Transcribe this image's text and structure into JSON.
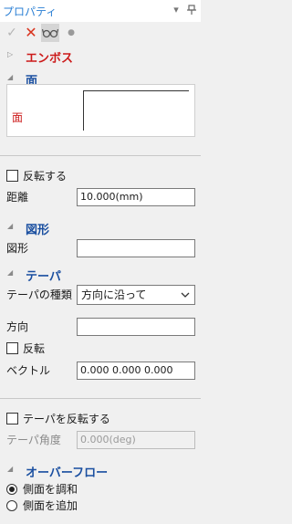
{
  "panel": {
    "title": "プロパティ",
    "pin_glyph": "▾",
    "dock_glyph": "ᵖ"
  },
  "toolbar": {
    "ok_glyph": "✓",
    "cancel_glyph": "✕",
    "preview_glyph": "∞",
    "dot_glyph": "●"
  },
  "sections": {
    "emboss": {
      "caret": "▷",
      "title": "エンボス"
    },
    "face": {
      "caret": "◢",
      "title": "面",
      "list_label": "面"
    },
    "reverse": {
      "label": "反転する",
      "checked": false
    },
    "distance": {
      "label": "距離",
      "value": "10.000(mm)"
    },
    "shape": {
      "caret": "◢",
      "title": "図形",
      "field_label": "図形",
      "value": ""
    },
    "taper": {
      "caret": "◢",
      "title": "テーパ",
      "type_label": "テーパの種類",
      "type_value": "方向に沿って",
      "direction_label": "方向",
      "direction_value": "",
      "flip_label": "反転",
      "flip_checked": false,
      "vector_label": "ベクトル",
      "vector_value": "0.000  0.000  0.000"
    },
    "taper_reverse": {
      "label": "テーパを反転する",
      "checked": false
    },
    "taper_angle": {
      "label": "テーパ角度",
      "value": "0.000(deg)"
    },
    "overflow": {
      "caret": "◢",
      "title": "オーバーフロー",
      "options": [
        {
          "label": "側面を調和",
          "selected": true
        },
        {
          "label": "側面を追加",
          "selected": false
        }
      ]
    }
  },
  "colors": {
    "title_blue": "#2a7fd4",
    "section_blue": "#1a4fa0",
    "emboss_red": "#cc1a1a"
  }
}
